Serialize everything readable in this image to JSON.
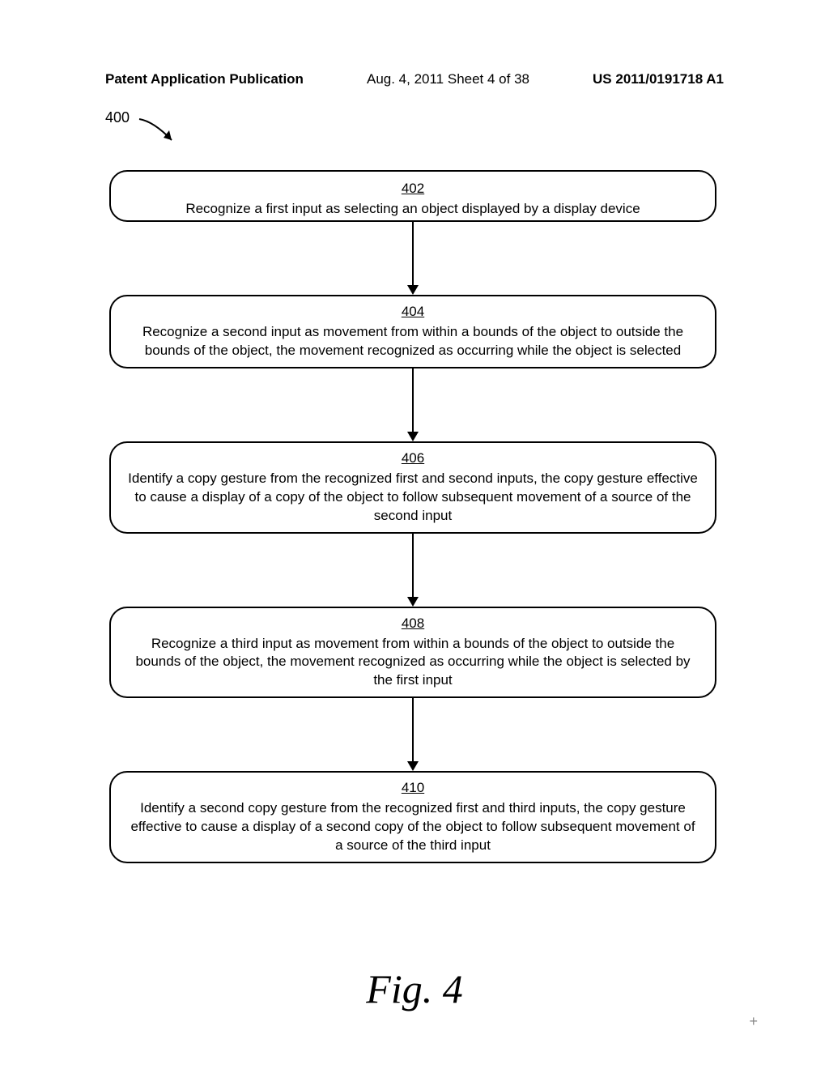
{
  "header": {
    "left": "Patent Application Publication",
    "center": "Aug. 4, 2011   Sheet 4 of 38",
    "right": "US 2011/0191718 A1"
  },
  "figure_ref": "400",
  "chart_data": {
    "type": "flowchart",
    "direction": "top-to-bottom",
    "nodes": [
      {
        "id": "402",
        "text": "Recognize a first input as selecting an object displayed by a display device"
      },
      {
        "id": "404",
        "text": "Recognize a second input as movement from within a bounds of the object to outside the bounds of the object, the movement recognized as occurring while the object is selected"
      },
      {
        "id": "406",
        "text": "Identify a copy gesture from the recognized first and second inputs, the copy gesture effective to cause a display of a copy of the object to follow subsequent movement of a source of the second input"
      },
      {
        "id": "408",
        "text": "Recognize a third input as movement from within a bounds of the object to outside the bounds of the object, the movement recognized as occurring while the object is selected by the first input"
      },
      {
        "id": "410",
        "text": "Identify a second copy gesture from the recognized first and third inputs, the copy gesture effective to cause a display of a second copy of the object to follow subsequent movement of a source of the third input"
      }
    ],
    "edges": [
      {
        "from": "402",
        "to": "404"
      },
      {
        "from": "404",
        "to": "406"
      },
      {
        "from": "406",
        "to": "408"
      },
      {
        "from": "408",
        "to": "410"
      }
    ]
  },
  "figure_label": "Fig. 4"
}
